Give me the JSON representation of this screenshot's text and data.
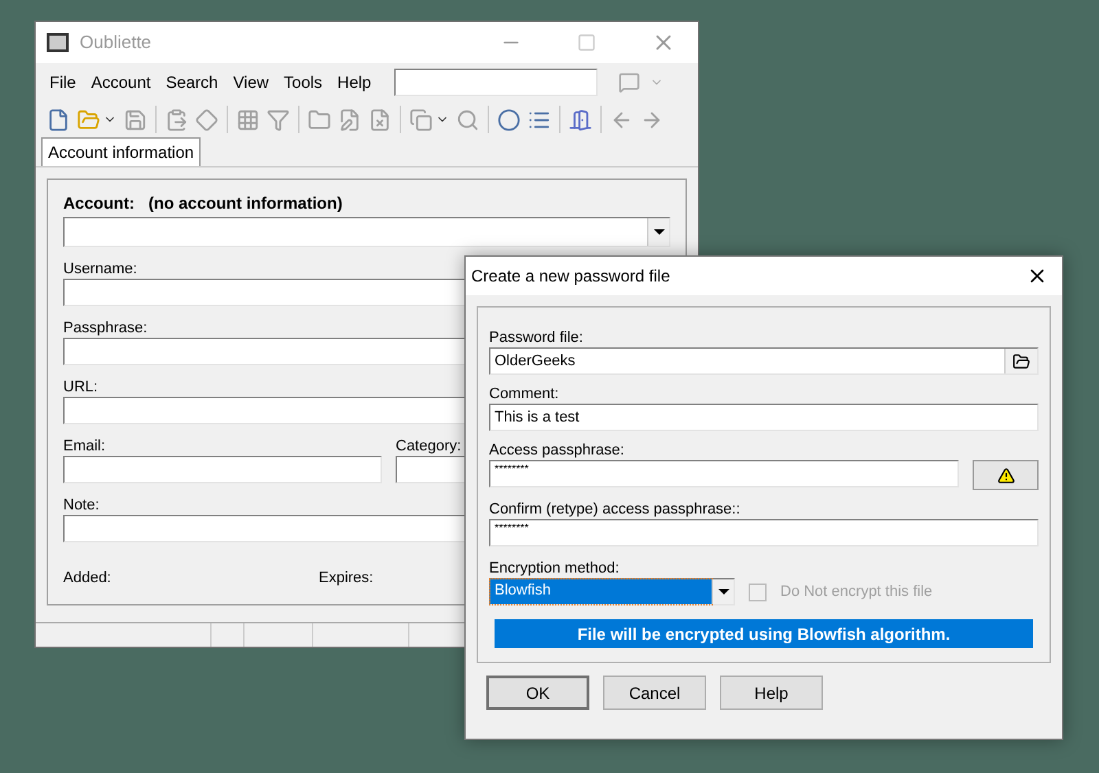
{
  "main_window": {
    "title": "Oubliette",
    "menu": [
      "File",
      "Account",
      "Search",
      "View",
      "Tools",
      "Help"
    ],
    "toolbar": [
      {
        "kind": "new",
        "disabled": false
      },
      {
        "kind": "open",
        "disabled": false
      },
      {
        "kind": "save",
        "disabled": true
      },
      {
        "kind": "sep"
      },
      {
        "kind": "paste",
        "disabled": true
      },
      {
        "kind": "diamond",
        "disabled": true
      },
      {
        "kind": "sep"
      },
      {
        "kind": "grid",
        "disabled": true
      },
      {
        "kind": "filter",
        "disabled": true
      },
      {
        "kind": "sep"
      },
      {
        "kind": "folder",
        "disabled": true
      },
      {
        "kind": "edit",
        "disabled": true
      },
      {
        "kind": "delete",
        "disabled": true
      },
      {
        "kind": "sep"
      },
      {
        "kind": "copy",
        "disabled": true
      },
      {
        "kind": "find",
        "disabled": true
      },
      {
        "kind": "sep"
      },
      {
        "kind": "ball",
        "disabled": false
      },
      {
        "kind": "list",
        "disabled": false
      },
      {
        "kind": "sep"
      },
      {
        "kind": "door",
        "disabled": false
      },
      {
        "kind": "sep"
      },
      {
        "kind": "back",
        "disabled": true
      },
      {
        "kind": "forward",
        "disabled": true
      }
    ],
    "tabs": [
      {
        "label": "Account information",
        "selected": true
      }
    ],
    "account": {
      "label": "Account:",
      "value": "(no account information)"
    },
    "fields": [
      {
        "label": "Username:"
      },
      {
        "label": "Passphrase:"
      },
      {
        "label": "URL:"
      }
    ],
    "email_label": "Email:",
    "category_label": "Category:",
    "note_label": "Note:",
    "added_label": "Added:",
    "expires_label": "Expires:"
  },
  "dialog": {
    "title": "Create a new password file",
    "password_file": {
      "label": "Password file:",
      "value": "OlderGeeks"
    },
    "comment": {
      "label": "Comment:",
      "value": "This is a test"
    },
    "access": {
      "label": "Access passphrase:",
      "value": "********"
    },
    "confirm": {
      "label": "Confirm (retype) access passphrase::",
      "value": "********"
    },
    "encryption": {
      "label": "Encryption method:",
      "value": "Blowfish"
    },
    "no_encrypt": {
      "label": "Do Not encrypt this file",
      "checked": false,
      "disabled": true
    },
    "banner": "File will be encrypted using Blowfish algorithm.",
    "buttons": [
      "OK",
      "Cancel",
      "Help"
    ]
  }
}
